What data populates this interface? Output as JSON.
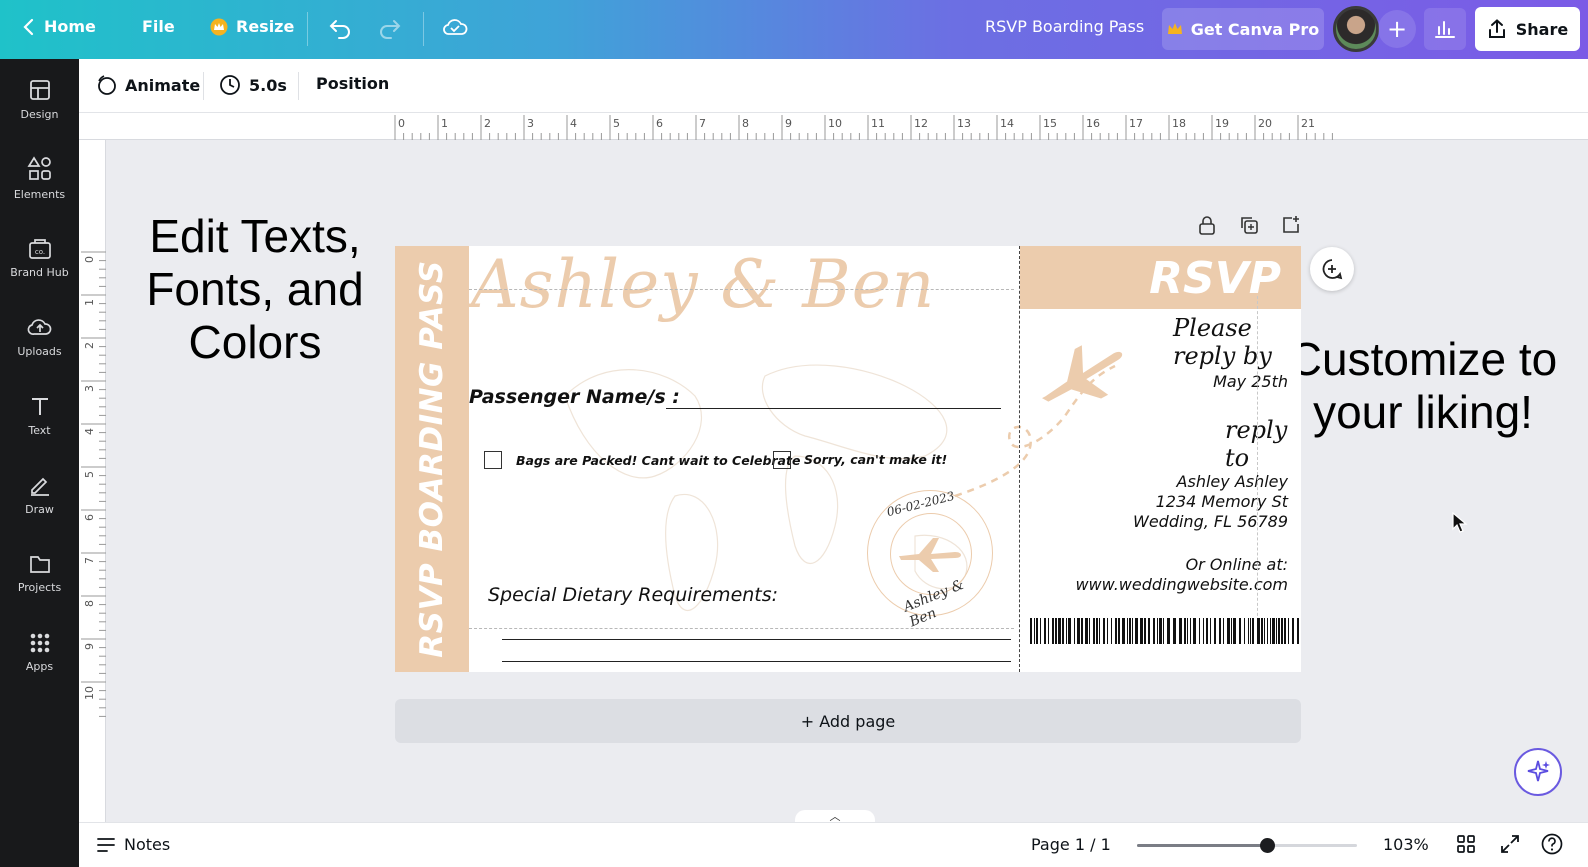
{
  "topbar": {
    "home_label": "Home",
    "file_label": "File",
    "resize_label": "Resize",
    "doc_title": "RSVP Boarding Pass",
    "pro_label": "Get Canva Pro",
    "share_label": "Share"
  },
  "sidebar": {
    "items": [
      {
        "label": "Design",
        "icon": "design-icon"
      },
      {
        "label": "Elements",
        "icon": "elements-icon"
      },
      {
        "label": "Brand Hub",
        "icon": "brand-hub-icon"
      },
      {
        "label": "Uploads",
        "icon": "upload-icon"
      },
      {
        "label": "Text",
        "icon": "text-icon"
      },
      {
        "label": "Draw",
        "icon": "draw-icon"
      },
      {
        "label": "Projects",
        "icon": "folder-icon"
      },
      {
        "label": "Apps",
        "icon": "apps-icon"
      }
    ]
  },
  "toolbar": {
    "animate_label": "Animate",
    "duration_label": "5.0s",
    "position_label": "Position"
  },
  "ruler": {
    "h_numbers": [
      "0",
      "1",
      "2",
      "3",
      "4",
      "5",
      "6",
      "7",
      "8",
      "9",
      "10",
      "11",
      "12",
      "13",
      "14",
      "15",
      "16",
      "17",
      "18",
      "19",
      "20",
      "21"
    ],
    "v_numbers": [
      "0",
      "1",
      "2",
      "3",
      "4",
      "5",
      "6",
      "7",
      "8",
      "9",
      "10"
    ]
  },
  "canvas": {
    "left_text": "Edit Texts, Fonts, and Colors",
    "right_text": "Customize to your liking!",
    "add_page_label": "+ Add page"
  },
  "boarding_pass": {
    "stripe_text": "RSVP BOARDING PASS",
    "couple_names": "Ashley & Ben",
    "passenger_label": "Passenger Name/s :",
    "option_yes": "Bags are Packed! Cant wait to Celebrate",
    "option_no": "Sorry, can't make it!",
    "dietary_label": "Special Dietary Requirements:",
    "stamp_date": "06-02-2023",
    "stamp_signature": "Ashley & Ben",
    "rsvp_title": "RSVP",
    "please_reply": "Please reply by",
    "reply_date": "May 25th",
    "reply_to": "reply to",
    "address_name": "Ashley Ashley",
    "address_street": "1234 Memory St",
    "address_city": "Wedding, FL 56789",
    "online_label": "Or Online at:",
    "website": "www.weddingwebsite.com",
    "accent_color": "#ecccad"
  },
  "bottombar": {
    "notes_label": "Notes",
    "page_label": "Page 1 / 1",
    "zoom_label": "103%",
    "zoom_fraction": 0.59
  }
}
